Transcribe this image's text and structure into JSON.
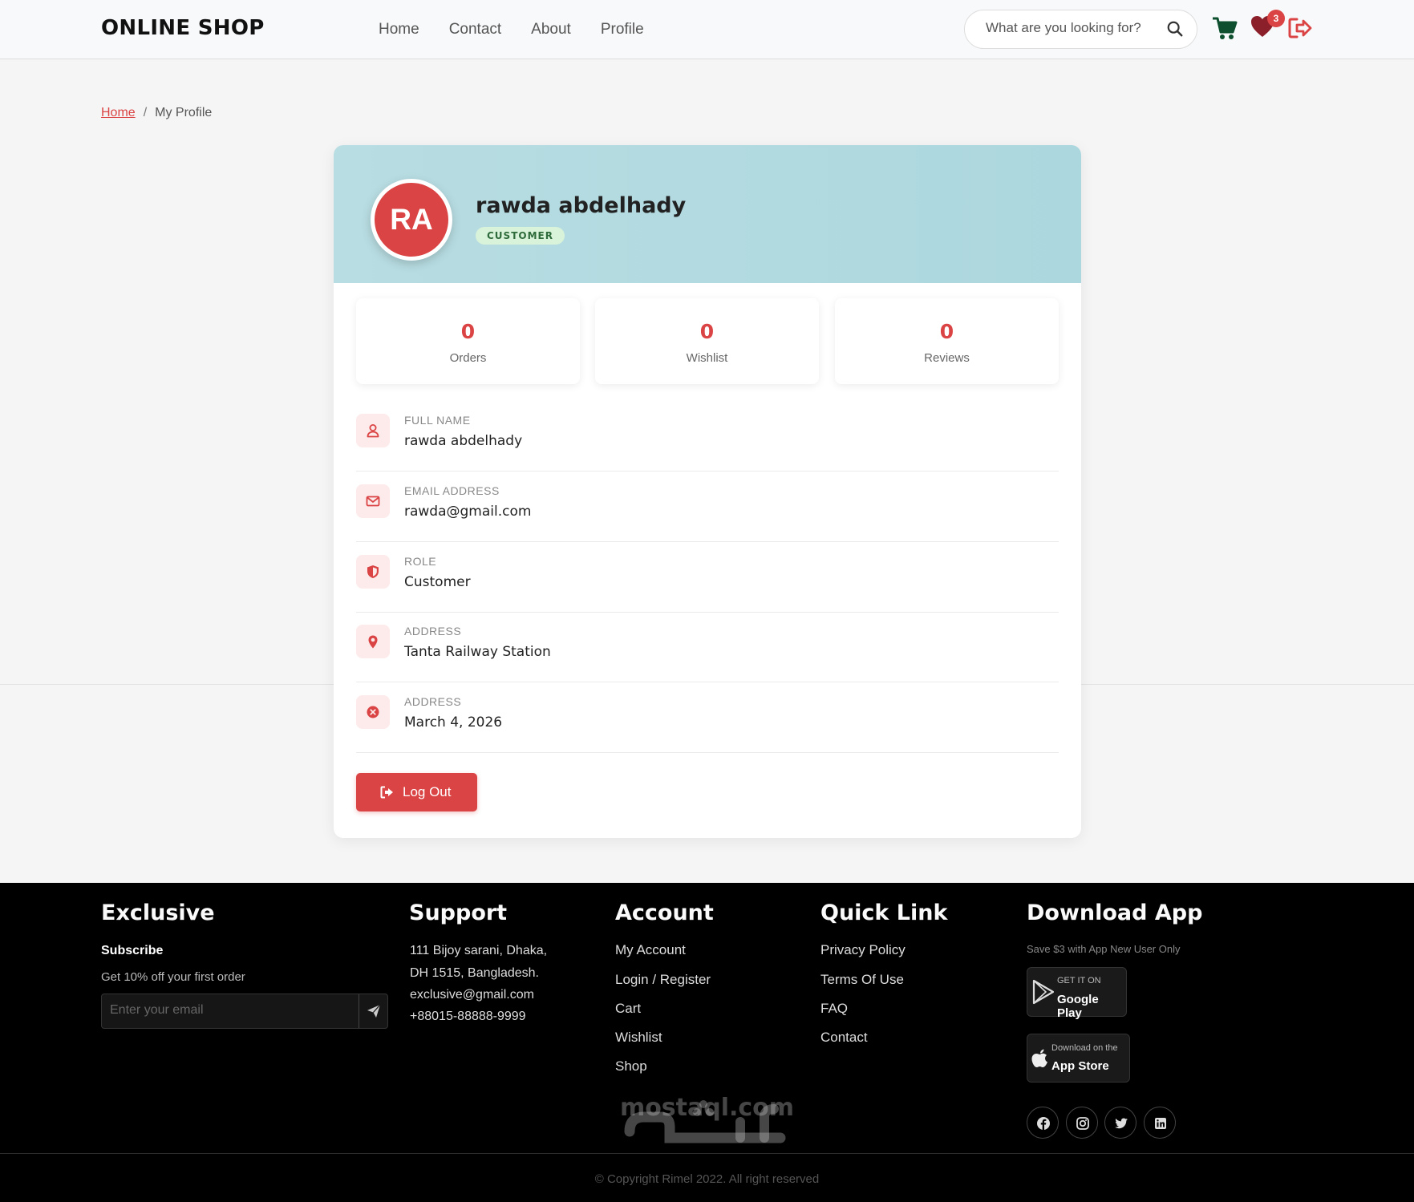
{
  "header": {
    "logo": "ONLINE SHOP",
    "nav": [
      "Home",
      "Contact",
      "About",
      "Profile"
    ],
    "search_placeholder": "What are you looking for?",
    "wishlist_count": "3"
  },
  "breadcrumb": {
    "home": "Home",
    "separator": "/",
    "current": "My Profile"
  },
  "profile": {
    "initials": "RA",
    "name": "rawda abdelhady",
    "role_chip": "CUSTOMER",
    "stats": [
      {
        "value": "0",
        "label": "Orders"
      },
      {
        "value": "0",
        "label": "Wishlist"
      },
      {
        "value": "0",
        "label": "Reviews"
      }
    ],
    "fields": [
      {
        "label": "FULL NAME",
        "value": "rawda abdelhady",
        "icon": "user-icon"
      },
      {
        "label": "EMAIL ADDRESS",
        "value": "rawda@gmail.com",
        "icon": "envelope-icon"
      },
      {
        "label": "ROLE",
        "value": "Customer",
        "icon": "shield-icon"
      },
      {
        "label": "ADDRESS",
        "value": "Tanta Railway Station",
        "icon": "map-pin-icon"
      },
      {
        "label": "ADDRESS",
        "value": "March 4, 2026",
        "icon": "close-circle-icon"
      }
    ],
    "logout_label": "Log Out"
  },
  "footer": {
    "exclusive": {
      "heading": "Exclusive",
      "subscribe": "Subscribe",
      "offer": "Get 10% off your first order",
      "email_placeholder": "Enter your email"
    },
    "support": {
      "heading": "Support",
      "lines": [
        "111 Bijoy sarani, Dhaka,",
        "DH 1515, Bangladesh.",
        "exclusive@gmail.com",
        "+88015-88888-9999"
      ]
    },
    "account": {
      "heading": "Account",
      "links": [
        "My Account",
        "Login / Register",
        "Cart",
        "Wishlist",
        "Shop"
      ]
    },
    "quick_link": {
      "heading": "Quick Link",
      "links": [
        "Privacy Policy",
        "Terms Of Use",
        "FAQ",
        "Contact"
      ]
    },
    "download": {
      "heading": "Download App",
      "note": "Save $3 with App New User Only",
      "google_small": "GET IT ON",
      "google_big": "Google Play",
      "apple_small": "Download on the",
      "apple_big": "App Store",
      "social": [
        "facebook-icon",
        "instagram-icon",
        "twitter-icon",
        "linkedin-icon"
      ]
    },
    "copyright": "© Copyright Rimel 2022. All right reserved",
    "watermark": "mostaql.com"
  },
  "colors": {
    "accent": "#db4444",
    "header_banner": "#b3dbe0",
    "chip_bg": "#d9f3da",
    "footer_bg": "#000000"
  }
}
